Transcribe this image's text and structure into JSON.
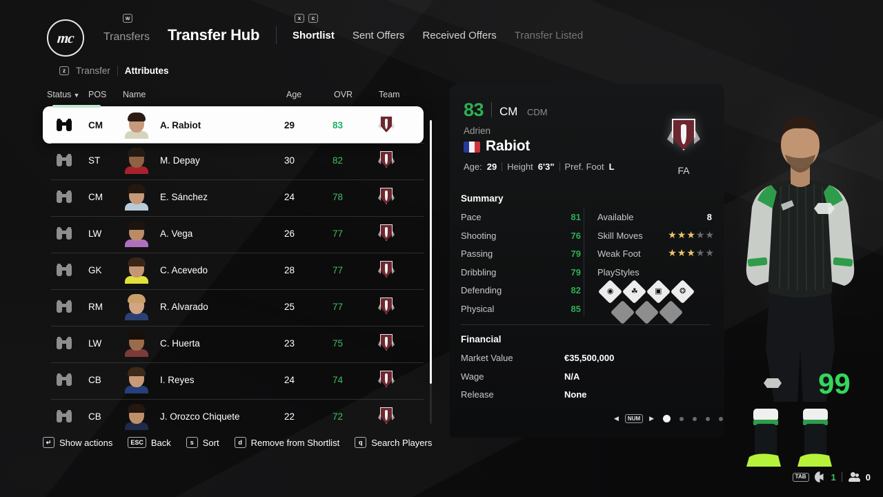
{
  "header": {
    "logo_text": "mc",
    "key_w": "w",
    "key_x": "x",
    "key_c": "c",
    "prev_section": "Transfers",
    "title": "Transfer Hub",
    "tabs": [
      {
        "label": "Shortlist",
        "state": "active"
      },
      {
        "label": "Sent Offers",
        "state": "normal"
      },
      {
        "label": "Received Offers",
        "state": "normal"
      },
      {
        "label": "Transfer Listed",
        "state": "dim"
      }
    ]
  },
  "subnav": {
    "key": "z",
    "items": [
      {
        "label": "Transfer",
        "state": "normal"
      },
      {
        "label": "Attributes",
        "state": "active"
      }
    ]
  },
  "table": {
    "columns": [
      "Status",
      "POS",
      "Name",
      "Age",
      "OVR",
      "Team"
    ],
    "sort_indicator": "▼",
    "status_icon": "binoculars-icon",
    "rows": [
      {
        "pos": "CM",
        "name": "A. Rabiot",
        "age": "29",
        "ovr": "83",
        "selected": true,
        "skin": "#c79a7c",
        "hair": "#2a1c14",
        "kit": "#d8d2bc"
      },
      {
        "pos": "ST",
        "name": "M. Depay",
        "age": "30",
        "ovr": "82",
        "selected": false,
        "skin": "#8f6243",
        "hair": "#241a14",
        "kit": "#a8222c"
      },
      {
        "pos": "CM",
        "name": "E. Sánchez",
        "age": "24",
        "ovr": "78",
        "selected": false,
        "skin": "#c69a78",
        "hair": "#241810",
        "kit": "#b8cbd8"
      },
      {
        "pos": "LW",
        "name": "A. Vega",
        "age": "26",
        "ovr": "77",
        "selected": false,
        "skin": "#bb8b68",
        "hair": "#1d1410",
        "kit": "#b06fbe"
      },
      {
        "pos": "GK",
        "name": "C. Acevedo",
        "age": "28",
        "ovr": "77",
        "selected": false,
        "skin": "#c49676",
        "hair": "#3a2418",
        "kit": "#e2e03a"
      },
      {
        "pos": "RM",
        "name": "R. Alvarado",
        "age": "25",
        "ovr": "77",
        "selected": false,
        "skin": "#d2a584",
        "hair": "#caa06a",
        "kit": "#2b3f72"
      },
      {
        "pos": "LW",
        "name": "C. Huerta",
        "age": "23",
        "ovr": "75",
        "selected": false,
        "skin": "#9c6b4a",
        "hair": "#171008",
        "kit": "#7c3a3a"
      },
      {
        "pos": "CB",
        "name": "I. Reyes",
        "age": "24",
        "ovr": "74",
        "selected": false,
        "skin": "#c99a78",
        "hair": "#3d2a18",
        "kit": "#26407a"
      },
      {
        "pos": "CB",
        "name": "J. Orozco Chiquete",
        "age": "22",
        "ovr": "72",
        "selected": false,
        "skin": "#c08f6c",
        "hair": "#231710",
        "kit": "#1f2a4a"
      }
    ]
  },
  "detail": {
    "ovr": "83",
    "position": "CM",
    "position_alt": "CDM",
    "first_name": "Adrien",
    "last_name": "Rabiot",
    "nation": "France",
    "age_label": "Age:",
    "age": "29",
    "height_label": "Height",
    "height": "6'3\"",
    "foot_label": "Pref. Foot",
    "foot": "L",
    "club_status": "FA",
    "club_crest": "club-crest-icon",
    "summary": {
      "title": "Summary",
      "attributes": [
        {
          "name": "Pace",
          "value": "81"
        },
        {
          "name": "Shooting",
          "value": "76"
        },
        {
          "name": "Passing",
          "value": "79"
        },
        {
          "name": "Dribbling",
          "value": "79"
        },
        {
          "name": "Defending",
          "value": "82"
        },
        {
          "name": "Physical",
          "value": "85"
        }
      ],
      "available_label": "Available",
      "available_value": "8",
      "skill_moves_label": "Skill Moves",
      "skill_moves": 3,
      "weak_foot_label": "Weak Foot",
      "weak_foot": 3,
      "stars_total": 5,
      "playstyles_label": "PlayStyles",
      "playstyles": [
        {
          "icon": "anticipate-icon",
          "glyph": "◉",
          "filled": true
        },
        {
          "icon": "bruiser-icon",
          "glyph": "☘",
          "filled": true
        },
        {
          "icon": "intercept-icon",
          "glyph": "▣",
          "filled": true
        },
        {
          "icon": "pinged-pass-icon",
          "glyph": "❂",
          "filled": true
        },
        {
          "icon": "empty-playstyle-icon",
          "glyph": "",
          "filled": false
        },
        {
          "icon": "empty-playstyle-icon",
          "glyph": "",
          "filled": false
        },
        {
          "icon": "empty-playstyle-icon",
          "glyph": "",
          "filled": false
        }
      ]
    },
    "financial": {
      "title": "Financial",
      "rows": [
        {
          "name": "Market Value",
          "value": "€35,500,000"
        },
        {
          "name": "Wage",
          "value": "N/A"
        },
        {
          "name": "Release",
          "value": "None"
        }
      ]
    },
    "pager": {
      "prev_glyph": "◀",
      "key": "NUM",
      "next_glyph": "▶",
      "pages": 5,
      "current": 1
    }
  },
  "player_render": {
    "shirt_number": "99",
    "kit_primary": "#1d211f",
    "kit_accent": "#2e9c4a",
    "kit_sleeve": "#c9cdc8",
    "boots": "#b6f23a"
  },
  "footer": {
    "actions": [
      {
        "key": "↵",
        "label": "Show actions"
      },
      {
        "key": "ESC",
        "label": "Back"
      },
      {
        "key": "s",
        "label": "Sort"
      },
      {
        "key": "d",
        "label": "Remove from Shortlist"
      },
      {
        "key": "q",
        "label": "Search Players"
      }
    ]
  },
  "status_bar": {
    "key": "TAB",
    "volume_icon": "speaker-icon",
    "volume_value": "1",
    "people_icon": "people-icon",
    "people_value": "0"
  },
  "colors": {
    "accent_green": "#2fae55",
    "row_selected_bg": "#fdfdfd",
    "panel_bg": "#121314",
    "page_bg": "#0a0a0b",
    "star_gold": "#f0c468"
  }
}
